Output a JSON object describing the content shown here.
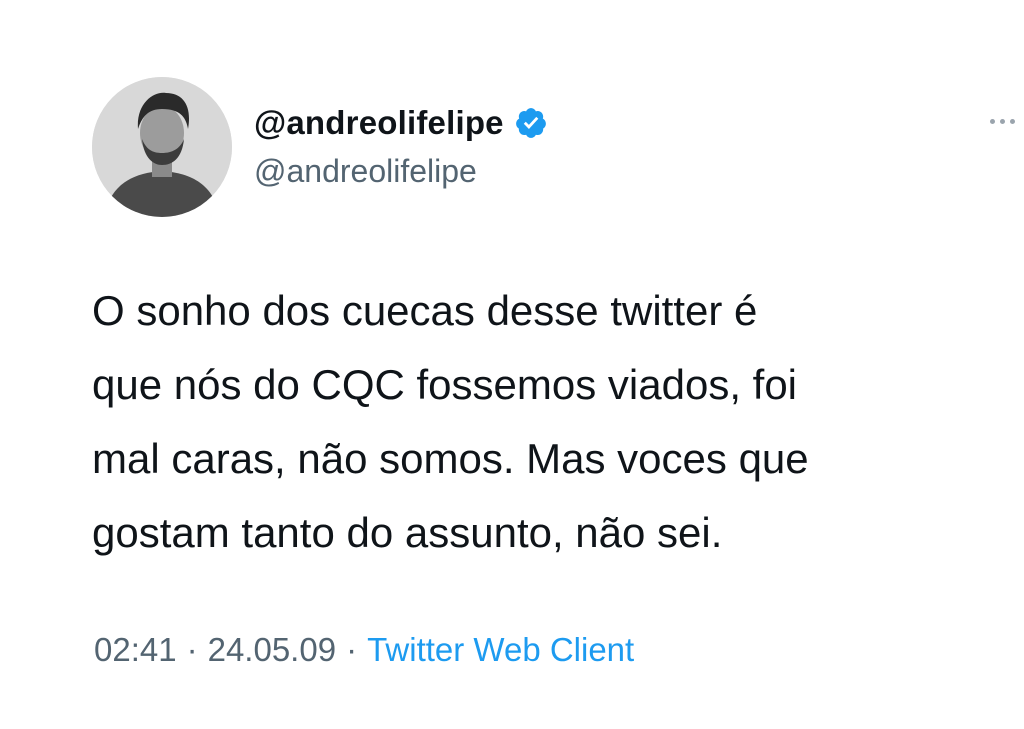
{
  "author": {
    "display_name": "@andreolifelipe",
    "handle": "@andreolifelipe",
    "verified": true,
    "avatar_icon": "profile-photo"
  },
  "tweet": {
    "lines": [
      "O sonho dos cuecas desse twitter é",
      "que nós do CQC fossemos viados, foi",
      "mal caras, não somos. Mas voces que",
      "gostam tanto do assunto, não sei."
    ]
  },
  "meta": {
    "time": "02:41",
    "date": "24.05.09",
    "separator": "·",
    "client": "Twitter Web Client"
  },
  "colors": {
    "text": "#0f1419",
    "secondary": "#536471",
    "accent": "#1d9bf0"
  },
  "icons": {
    "verified": "verified-badge-icon",
    "more": "more-options-icon"
  }
}
